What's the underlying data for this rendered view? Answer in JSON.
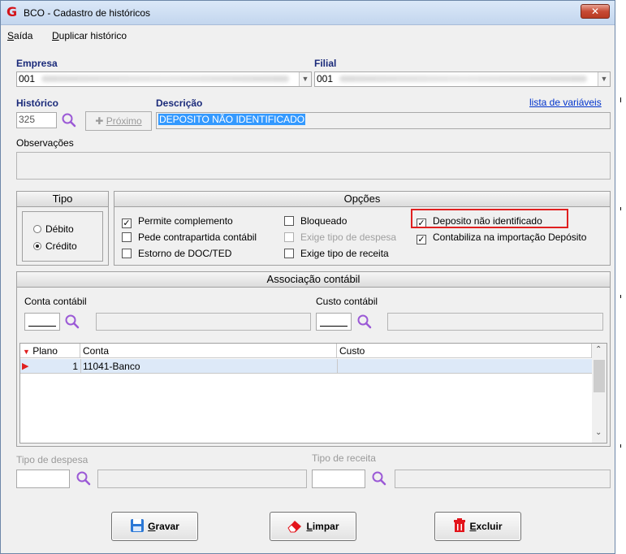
{
  "window": {
    "title": "BCO - Cadastro de históricos",
    "close_glyph": "✕"
  },
  "menu": {
    "items": [
      {
        "label_u": "S",
        "label_rest": "aída"
      },
      {
        "label_u": "D",
        "label_rest": "uplicar histórico"
      }
    ]
  },
  "empresa": {
    "label": "Empresa",
    "value": "001"
  },
  "filial": {
    "label": "Filial",
    "value": "001"
  },
  "historico": {
    "label": "Histórico",
    "value": "325",
    "next_label": "Próximo"
  },
  "descricao": {
    "label": "Descrição",
    "value": "DEPOSITO NÃO IDENTIFICADO"
  },
  "lista_variaveis": "lista de variáveis",
  "observacoes": {
    "label": "Observações",
    "value": ""
  },
  "tipo": {
    "title": "Tipo",
    "options": [
      {
        "label": "Débito",
        "selected": false
      },
      {
        "label": "Crédito",
        "selected": true
      }
    ]
  },
  "opcoes": {
    "title": "Opções",
    "items": [
      {
        "label": "Permite complemento",
        "checked": true,
        "enabled": true
      },
      {
        "label": "Pede contrapartida contábil",
        "checked": false,
        "enabled": true
      },
      {
        "label": "Estorno de DOC/TED",
        "checked": false,
        "enabled": true
      },
      {
        "label": "Bloqueado",
        "checked": false,
        "enabled": true
      },
      {
        "label": "Exige tipo de despesa",
        "checked": false,
        "enabled": false
      },
      {
        "label": "Exige tipo de receita",
        "checked": false,
        "enabled": true
      },
      {
        "label": "Deposito não identificado",
        "checked": true,
        "enabled": true
      },
      {
        "label": "Contabiliza na importação Depósito",
        "checked": true,
        "enabled": true
      }
    ]
  },
  "associacao": {
    "title": "Associação contábil",
    "conta_label": "Conta contábil",
    "custo_label": "Custo contábil",
    "grid": {
      "headers": [
        "Plano",
        "Conta",
        "Custo"
      ],
      "rows": [
        {
          "plano": "1",
          "conta": "11041-Banco",
          "custo": ""
        }
      ]
    }
  },
  "tipo_despesa": {
    "label": "Tipo de despesa"
  },
  "tipo_receita": {
    "label": "Tipo de receita"
  },
  "buttons": {
    "gravar": {
      "u": "G",
      "rest": "ravar"
    },
    "limpar": {
      "u": "L",
      "rest": "impar"
    },
    "excluir": {
      "u": "E",
      "rest": "xcluir"
    }
  },
  "colors": {
    "accent_red": "#e02020",
    "selection_blue": "#3399ff",
    "link_blue": "#0033cc",
    "search_purple": "#9b59d6"
  },
  "icons": [
    "app-logo-icon",
    "close-icon",
    "search-icon",
    "plus-icon",
    "chevron-down-icon",
    "save-icon",
    "eraser-icon",
    "trash-icon",
    "row-pointer-icon"
  ]
}
